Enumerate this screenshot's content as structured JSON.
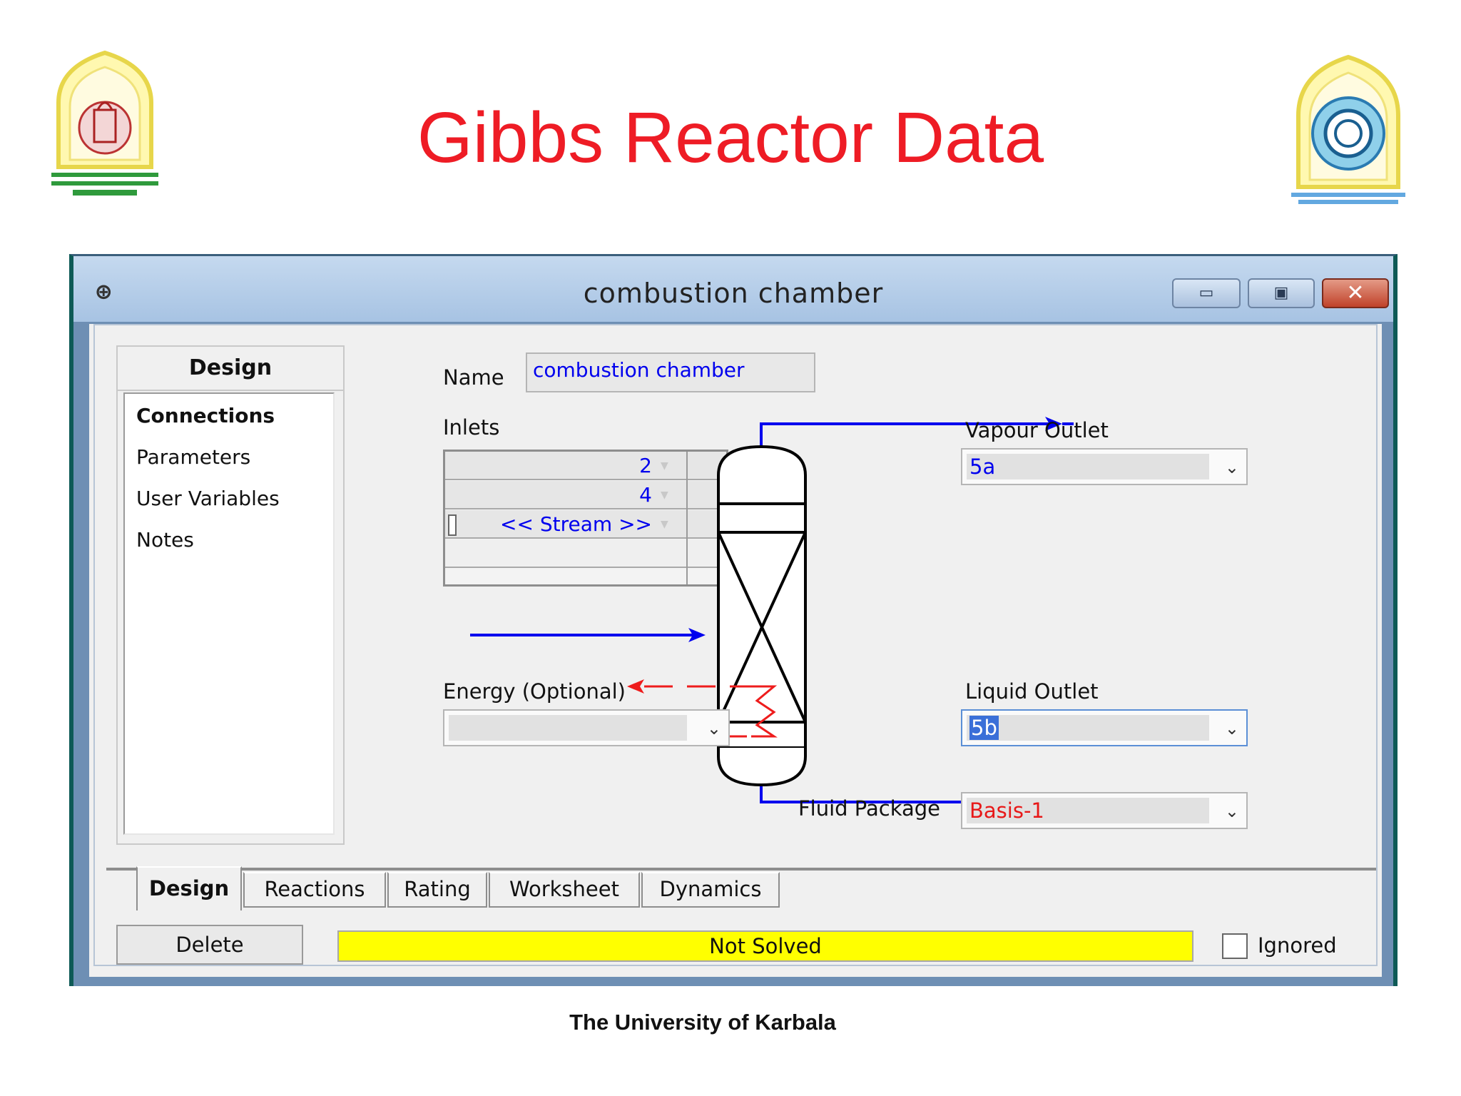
{
  "slide": {
    "title": "Gibbs Reactor Data",
    "footer": "The University of Karbala"
  },
  "window": {
    "title": "combustion chamber",
    "icon": "hysys-icon",
    "controls": {
      "minimize": "▭",
      "maximize": "▣",
      "close": "✕"
    }
  },
  "nav": {
    "header": "Design",
    "items": [
      {
        "label": "Connections",
        "selected": true
      },
      {
        "label": "Parameters",
        "selected": false
      },
      {
        "label": "User Variables",
        "selected": false
      },
      {
        "label": "Notes",
        "selected": false
      }
    ]
  },
  "name_field": {
    "label": "Name",
    "value": "combustion chamber"
  },
  "inlets": {
    "label": "Inlets",
    "rows": [
      "2",
      "4",
      "<< Stream >>",
      ""
    ]
  },
  "vapour_outlet": {
    "label": "Vapour Outlet",
    "value": "5a"
  },
  "liquid_outlet": {
    "label": "Liquid Outlet",
    "value": "5b"
  },
  "energy": {
    "label": "Energy (Optional)",
    "value": ""
  },
  "fluid_package": {
    "label": "Fluid Package",
    "value": "Basis-1",
    "color": "#e81818"
  },
  "tabs": [
    {
      "label": "Design",
      "active": true
    },
    {
      "label": "Reactions",
      "active": false
    },
    {
      "label": "Rating",
      "active": false
    },
    {
      "label": "Worksheet",
      "active": false
    },
    {
      "label": "Dynamics",
      "active": false
    }
  ],
  "footer_bar": {
    "delete_label": "Delete",
    "status": "Not Solved",
    "status_color": "#ffff00",
    "ignored_label": "Ignored",
    "ignored_checked": false
  },
  "colors": {
    "title_red": "#ee1c25",
    "stream_blue": "#0000ee",
    "energy_red": "#ee1c1c"
  }
}
